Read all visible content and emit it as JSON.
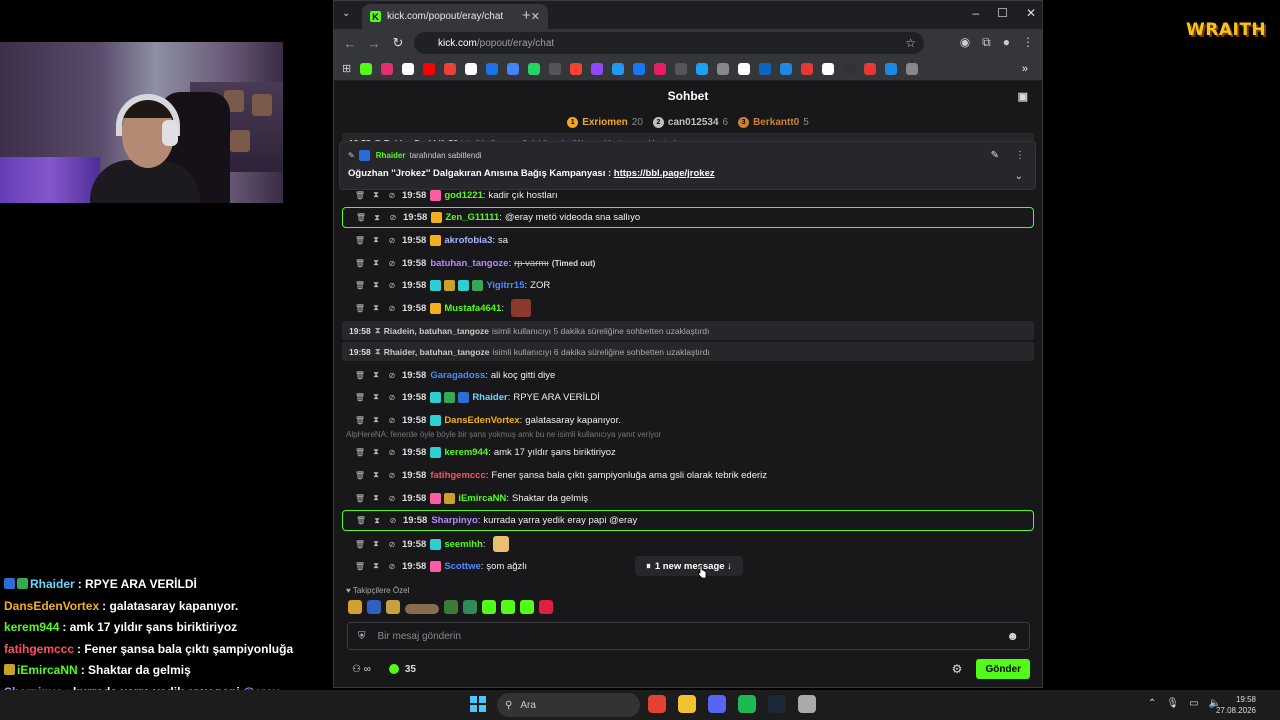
{
  "overlay": {
    "logo": "WRAITH",
    "chat": [
      {
        "name": "Rhaider",
        "text": "RPYE ARA VERİLDİ",
        "color": "#6ad6ff",
        "badges": [
          "#2b6dd6",
          "#34a853"
        ]
      },
      {
        "name": "DansEdenVortex",
        "text": "galatasaray kapanıyor.",
        "color": "#f2b01e"
      },
      {
        "name": "kerem944",
        "text": "amk 17 yıldır şans biriktiriyoz",
        "color": "#53fc18"
      },
      {
        "name": "fatihgemccc",
        "text": "Fener şansa bala çıktı şampiyonluğa",
        "color": "#ff4d6a"
      },
      {
        "name": "iEmircaNN",
        "text": "Shaktar da gelmiş",
        "color": "#53fc18",
        "badges": [
          "#c8a02a"
        ]
      },
      {
        "name": "Sharpinyo",
        "text": "kurrada yarra yedik eray papi",
        "mention": "@eray",
        "color": "#b48cff"
      },
      {
        "name": "seemihh",
        "text": "",
        "color": "#53fc18"
      }
    ]
  },
  "browser": {
    "tab_title": "kick.com/popout/eray/chat",
    "url_host": "kick.com",
    "url_path": "/popout/eray/chat",
    "bookmarks": [
      "#53fc18",
      "#e1306c",
      "#ffffff",
      "#ff0000",
      "#ea4335",
      "#ffffff",
      "#1a73e8",
      "#4285f4",
      "#25d366",
      "#555555",
      "#f44336",
      "#9146ff",
      "#2196f3",
      "#1877f2",
      "#e91e63",
      "#555555",
      "#1da1f2",
      "#888888",
      "#ffffff",
      "#0a66c2",
      "#1e88e5",
      "#e53935",
      "#ffffff",
      "#333333",
      "#e53935",
      "#1e88e5",
      "#888888"
    ]
  },
  "chat": {
    "header_title": "Sohbet",
    "leaderboard": [
      {
        "rank": "1",
        "name": "Exriomen",
        "count": "20",
        "color": "#f5a623"
      },
      {
        "rank": "2",
        "name": "can012534",
        "count": "6",
        "color": "#c0c0c0"
      },
      {
        "rank": "3",
        "name": "Berkantt0",
        "count": "5",
        "color": "#cd7f32"
      }
    ],
    "pinned": {
      "pinned_by": "Rhaider",
      "pinned_suffix": "tarafından sabitlendi",
      "message": "Oğuzhan ''Jrokez'' Dalgakıran Anısına Bağış Kampanyası :",
      "link": "https://bbl.page/jrokez"
    },
    "messages": [
      {
        "time": "19:58",
        "user": "Raider, DarkLife56",
        "text": "isimli kullanıcıyı 6 dakika süreliğine sohbetten uzaklaştırdı",
        "type": "sys"
      },
      {
        "time": "19:58",
        "user": "god1221",
        "text": "kadir çık hostları",
        "color": "#53fc18",
        "badges": [
          "#ff5ca8"
        ]
      },
      {
        "time": "19:58",
        "user": "Zen_G11111",
        "text": "@eray metö videoda sna sallıyo",
        "color": "#53fc18",
        "highlight": true,
        "badges": [
          "#f2b01e"
        ]
      },
      {
        "time": "19:58",
        "user": "akrofobia3",
        "text": "sa",
        "color": "#a8b4ff",
        "badges": [
          "#f2b01e"
        ]
      },
      {
        "time": "19:58",
        "user": "batuhan_tangoze",
        "text": "rp varmı",
        "color": "#b48cff",
        "deleted": true,
        "note": "(Timed out)"
      },
      {
        "time": "19:58",
        "user": "Yigitrr15",
        "text": "ZOR",
        "color": "#4a8bff",
        "badges": [
          "#2ecfd0",
          "#c8a02a",
          "#2ecfd0",
          "#34a853"
        ]
      },
      {
        "time": "19:58",
        "user": "Mustafa4641",
        "text": "",
        "color": "#53fc18",
        "badges": [
          "#f2b01e"
        ],
        "emote": true
      },
      {
        "time": "19:58",
        "user": "Riadein, batuhan_tangoze",
        "text": "isimli kullanıcıyı 5 dakika süreliğine sohbetten uzaklaştırdı",
        "type": "sys"
      },
      {
        "time": "19:58",
        "user": "Rhaider, batuhan_tangoze",
        "text": "isimli kullanıcıyı 6 dakika süreliğine sohbetten uzaklaştırdı",
        "type": "sys"
      },
      {
        "time": "19:58",
        "user": "Garagadoss",
        "text": "ali koç gitti diye",
        "color": "#4a8bff"
      },
      {
        "time": "19:58",
        "user": "Rhaider",
        "text": "RPYE ARA VERİLDİ",
        "color": "#6ad6ff",
        "badges": [
          "#2ecfd0",
          "#34a853",
          "#2b6dd6"
        ]
      },
      {
        "time": "19:58",
        "user": "DansEdenVortex",
        "text": "galatasaray kapanıyor.",
        "color": "#f2b01e",
        "badges": [
          "#2ecfd0"
        ]
      },
      {
        "time": "19:58",
        "user": "kerem944",
        "text": "amk 17 yıldır şans biriktiriyoz",
        "color": "#53fc18",
        "badges": [
          "#2ecfd0"
        ],
        "reply": "AlpHereNA: fenerde öyle böyle bir şans yokmuş amk bu ne isimli kullanıcıya yanıt veriyor"
      },
      {
        "time": "19:58",
        "user": "fatihgemccc",
        "text": "Fener şansa bala çıktı şampiyonluğa ama gsli olarak tebrik ederiz",
        "color": "#ff4d6a"
      },
      {
        "time": "19:58",
        "user": "iEmircaNN",
        "text": "Shaktar da gelmiş",
        "color": "#53fc18",
        "badges": [
          "#ff5ca8",
          "#c8a02a"
        ]
      },
      {
        "time": "19:58",
        "user": "Sharpinyo",
        "text": "kurrada yarra yedik eray papi @eray",
        "color": "#b48cff",
        "highlight": true
      },
      {
        "time": "19:58",
        "user": "seemihh",
        "text": "",
        "color": "#53fc18",
        "badges": [
          "#2ecfd0"
        ],
        "emote": true
      },
      {
        "time": "19:58",
        "user": "Scottwe",
        "text": "şom ağzlı",
        "color": "#4a8bff",
        "badges": [
          "#ff5ca8"
        ]
      }
    ],
    "new_message_label": "1 new message ↓",
    "followers_label": "Takipçilere Özel",
    "emotes": [
      "#d0a030",
      "#3060c0",
      "#c8a040",
      "#8a6a50",
      "#3a7a3a",
      "#2e8b57",
      "#53fc18",
      "#53fc18",
      "#53fc18",
      "#e02040"
    ],
    "input_placeholder": "Bir mesaj gönderin",
    "points": "35",
    "send_label": "Gönder"
  },
  "taskbar": {
    "search_label": "Ara",
    "apps": [
      "#e34133",
      "#f2c230",
      "#5865f2",
      "#1db954",
      "#1b2838",
      "#aaaaaa"
    ],
    "time": "19:58",
    "date": "27.08.2026"
  }
}
